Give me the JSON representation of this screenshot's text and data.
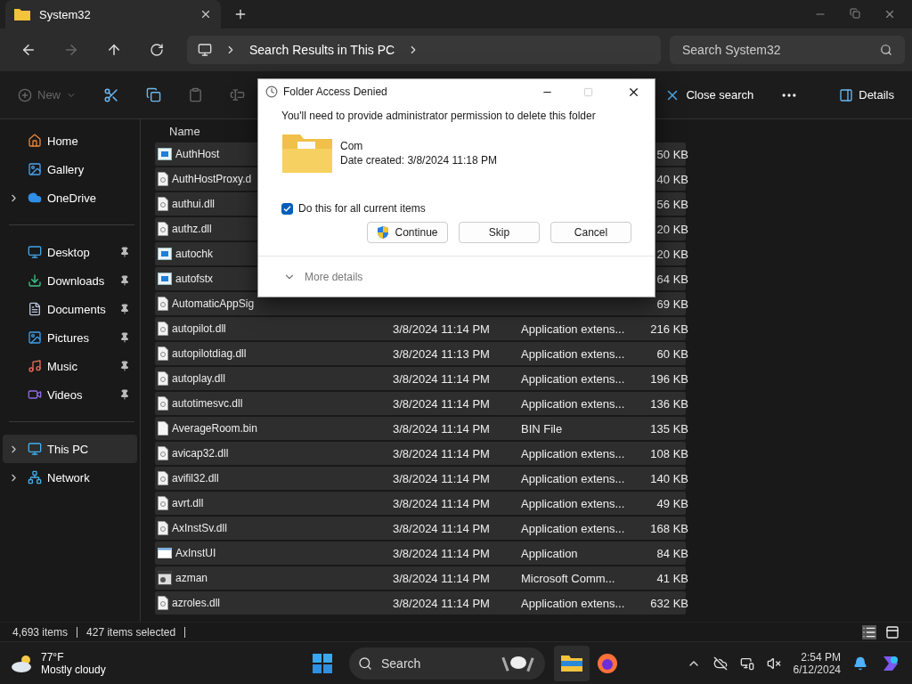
{
  "window": {
    "tab_title": "System32"
  },
  "nav": {
    "breadcrumb": [
      "Search Results in This PC"
    ],
    "search": {
      "placeholder": "Search System32"
    }
  },
  "toolbar": {
    "new": {
      "label": "New",
      "disabled": true
    },
    "close_search": "Close search",
    "details": "Details"
  },
  "sidebar": {
    "groups": [
      [
        {
          "label": "Home",
          "kind": "home",
          "pinned": false,
          "expandable": false,
          "selected": false
        },
        {
          "label": "Gallery",
          "kind": "gallery",
          "pinned": false,
          "expandable": false,
          "selected": false
        },
        {
          "label": "OneDrive",
          "kind": "cloud",
          "pinned": false,
          "expandable": true,
          "selected": false
        }
      ],
      [
        {
          "label": "Desktop",
          "kind": "desktop",
          "pinned": true,
          "expandable": false,
          "selected": false
        },
        {
          "label": "Downloads",
          "kind": "download",
          "pinned": true,
          "expandable": false,
          "selected": false
        },
        {
          "label": "Documents",
          "kind": "documents",
          "pinned": true,
          "expandable": false,
          "selected": false
        },
        {
          "label": "Pictures",
          "kind": "pictures",
          "pinned": true,
          "expandable": false,
          "selected": false
        },
        {
          "label": "Music",
          "kind": "music",
          "pinned": true,
          "expandable": false,
          "selected": false
        },
        {
          "label": "Videos",
          "kind": "videos",
          "pinned": true,
          "expandable": false,
          "selected": false
        }
      ],
      [
        {
          "label": "This PC",
          "kind": "pc",
          "pinned": false,
          "expandable": true,
          "selected": true
        },
        {
          "label": "Network",
          "kind": "network",
          "pinned": false,
          "expandable": true,
          "selected": false
        }
      ]
    ]
  },
  "table": {
    "columns": [
      "Name"
    ],
    "rows": [
      {
        "name": "AuthHost",
        "size": "50 KB",
        "kind": "app",
        "selected": true
      },
      {
        "name": "AuthHostProxy.d",
        "size": "40 KB",
        "kind": "dll",
        "selected": true
      },
      {
        "name": "authui.dll",
        "size": "56 KB",
        "kind": "dll",
        "selected": true
      },
      {
        "name": "authz.dll",
        "size": "20 KB",
        "kind": "dll",
        "selected": true
      },
      {
        "name": "autochk",
        "size": "20 KB",
        "kind": "app",
        "selected": true
      },
      {
        "name": "autofstx",
        "size": "64 KB",
        "kind": "app",
        "selected": true
      },
      {
        "name": "AutomaticAppSig",
        "size": "69 KB",
        "kind": "dll",
        "selected": true
      },
      {
        "name": "autopilot.dll",
        "date": "3/8/2024 11:14 PM",
        "type": "Application extens...",
        "size": "216 KB",
        "kind": "dll",
        "selected": true
      },
      {
        "name": "autopilotdiag.dll",
        "date": "3/8/2024 11:13 PM",
        "type": "Application extens...",
        "size": "60 KB",
        "kind": "dll",
        "selected": true
      },
      {
        "name": "autoplay.dll",
        "date": "3/8/2024 11:14 PM",
        "type": "Application extens...",
        "size": "196 KB",
        "kind": "dll",
        "selected": true
      },
      {
        "name": "autotimesvc.dll",
        "date": "3/8/2024 11:14 PM",
        "type": "Application extens...",
        "size": "136 KB",
        "kind": "dll",
        "selected": true
      },
      {
        "name": "AverageRoom.bin",
        "date": "3/8/2024 11:14 PM",
        "type": "BIN File",
        "size": "135 KB",
        "kind": "bin",
        "selected": true
      },
      {
        "name": "avicap32.dll",
        "date": "3/8/2024 11:14 PM",
        "type": "Application extens...",
        "size": "108 KB",
        "kind": "dll",
        "selected": true
      },
      {
        "name": "avifil32.dll",
        "date": "3/8/2024 11:14 PM",
        "type": "Application extens...",
        "size": "140 KB",
        "kind": "dll",
        "selected": true
      },
      {
        "name": "avrt.dll",
        "date": "3/8/2024 11:14 PM",
        "type": "Application extens...",
        "size": "49 KB",
        "kind": "dll",
        "selected": true
      },
      {
        "name": "AxInstSv.dll",
        "date": "3/8/2024 11:14 PM",
        "type": "Application extens...",
        "size": "168 KB",
        "kind": "dll",
        "selected": true
      },
      {
        "name": "AxInstUI",
        "date": "3/8/2024 11:14 PM",
        "type": "Application",
        "size": "84 KB",
        "kind": "window",
        "selected": true
      },
      {
        "name": "azman",
        "date": "3/8/2024 11:14 PM",
        "type": "Microsoft Comm...",
        "size": "41 KB",
        "kind": "msc",
        "selected": true
      },
      {
        "name": "azroles.dll",
        "date": "3/8/2024 11:14 PM",
        "type": "Application extens...",
        "size": "632 KB",
        "kind": "dll",
        "selected": true
      }
    ]
  },
  "status_bar": {
    "count": "4,693 items",
    "selected": "427 items selected"
  },
  "dialog": {
    "title": "Folder Access Denied",
    "maximize_disabled": true,
    "message": "You'll need to provide administrator permission to delete this folder",
    "item_name": "Com",
    "item_date": "Date created: 3/8/2024 11:18 PM",
    "checkbox": {
      "label": "Do this for all current items",
      "checked": true
    },
    "buttons": [
      {
        "label": "Continue",
        "kind": "shield"
      },
      {
        "label": "Skip",
        "kind": "plain"
      },
      {
        "label": "Cancel",
        "kind": "plain"
      }
    ],
    "more": "More details"
  },
  "taskbar": {
    "weather": {
      "temp": "77°F",
      "condition": "Mostly cloudy"
    },
    "search": {
      "placeholder": "Search"
    },
    "time": "2:54 PM",
    "date": "6/12/2024"
  }
}
